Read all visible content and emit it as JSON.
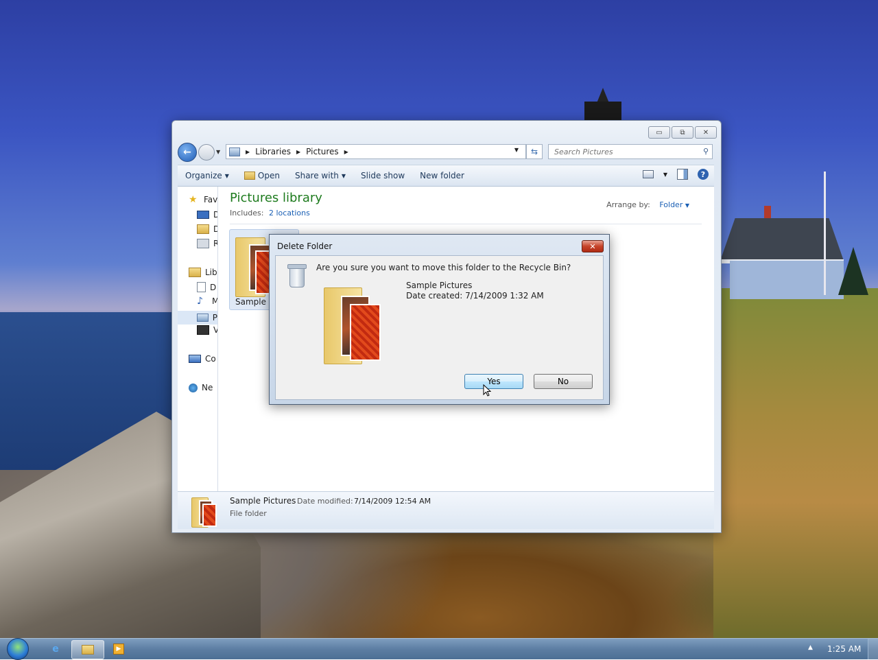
{
  "explorer": {
    "address": {
      "crumbs": [
        "Libraries",
        "Pictures"
      ]
    },
    "search": {
      "placeholder": "Search Pictures"
    },
    "toolbar": {
      "organize": "Organize",
      "open": "Open",
      "share_with": "Share with",
      "slide_show": "Slide show",
      "new_folder": "New folder"
    },
    "sidebar": {
      "items": [
        "Fav",
        "D",
        "D",
        "R",
        "Lib",
        "D",
        "M",
        "P",
        "V",
        "Co",
        "Ne"
      ]
    },
    "library": {
      "title": "Pictures library",
      "includes_label": "Includes:",
      "includes_link": "2 locations",
      "arrange_label": "Arrange by:",
      "arrange_value": "Folder"
    },
    "folder_tile": {
      "label": "Sample P"
    },
    "details": {
      "name": "Sample Pictures",
      "modified_label": "Date modified:",
      "modified_value": "7/14/2009 12:54 AM",
      "type": "File folder"
    }
  },
  "dialog": {
    "title": "Delete Folder",
    "question": "Are you sure you want to move this folder to the Recycle Bin?",
    "folder_name": "Sample Pictures",
    "date_created": "Date created: 7/14/2009 1:32 AM",
    "yes": "Yes",
    "no": "No"
  },
  "taskbar": {
    "clock": "1:25 AM"
  },
  "colors": {
    "library_title": "#1e7b1e",
    "link": "#1a5fb4",
    "close_button": "#c6442a"
  }
}
